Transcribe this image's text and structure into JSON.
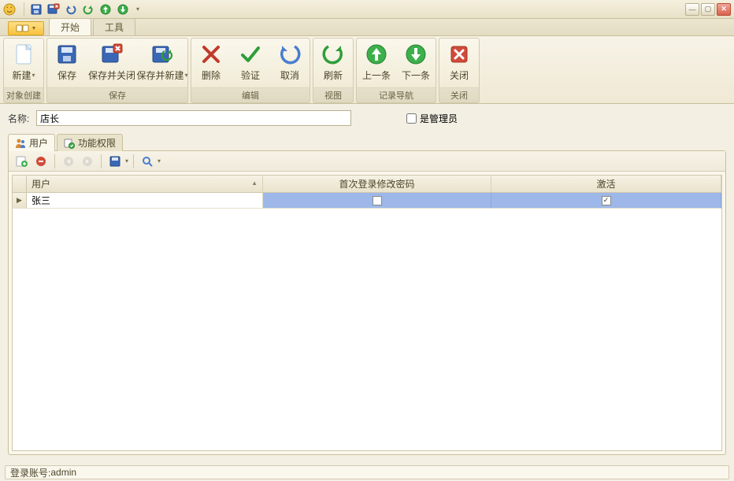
{
  "quick_access": {
    "dropdown_glyph": "▾"
  },
  "window_controls": {
    "min": "—",
    "max": "▢",
    "close": "✕"
  },
  "ribbon_tabs": {
    "start": "开始",
    "tools": "工具"
  },
  "ribbon": {
    "group_object_create": "对象创建",
    "group_save": "保存",
    "group_edit": "编辑",
    "group_view": "视图",
    "group_nav": "记录导航",
    "group_close": "关闭",
    "btn_new": "新建",
    "btn_save": "保存",
    "btn_save_close": "保存并关闭",
    "btn_save_new": "保存并新建",
    "btn_delete": "删除",
    "btn_validate": "验证",
    "btn_cancel": "取消",
    "btn_refresh": "刷新",
    "btn_prev": "上一条",
    "btn_next": "下一条",
    "btn_close": "关闭"
  },
  "form": {
    "name_label": "名称:",
    "name_value": "店长",
    "is_admin_label": "是管理员"
  },
  "inner_tabs": {
    "users": "用户",
    "perms": "功能权限"
  },
  "grid": {
    "col_user": "用户",
    "col_first_login": "首次登录修改密码",
    "col_active": "激活",
    "rows": [
      {
        "user": "张三",
        "first_login_change": false,
        "active": true
      }
    ]
  },
  "status": {
    "login_label": "登录账号: ",
    "login_value": "admin"
  }
}
